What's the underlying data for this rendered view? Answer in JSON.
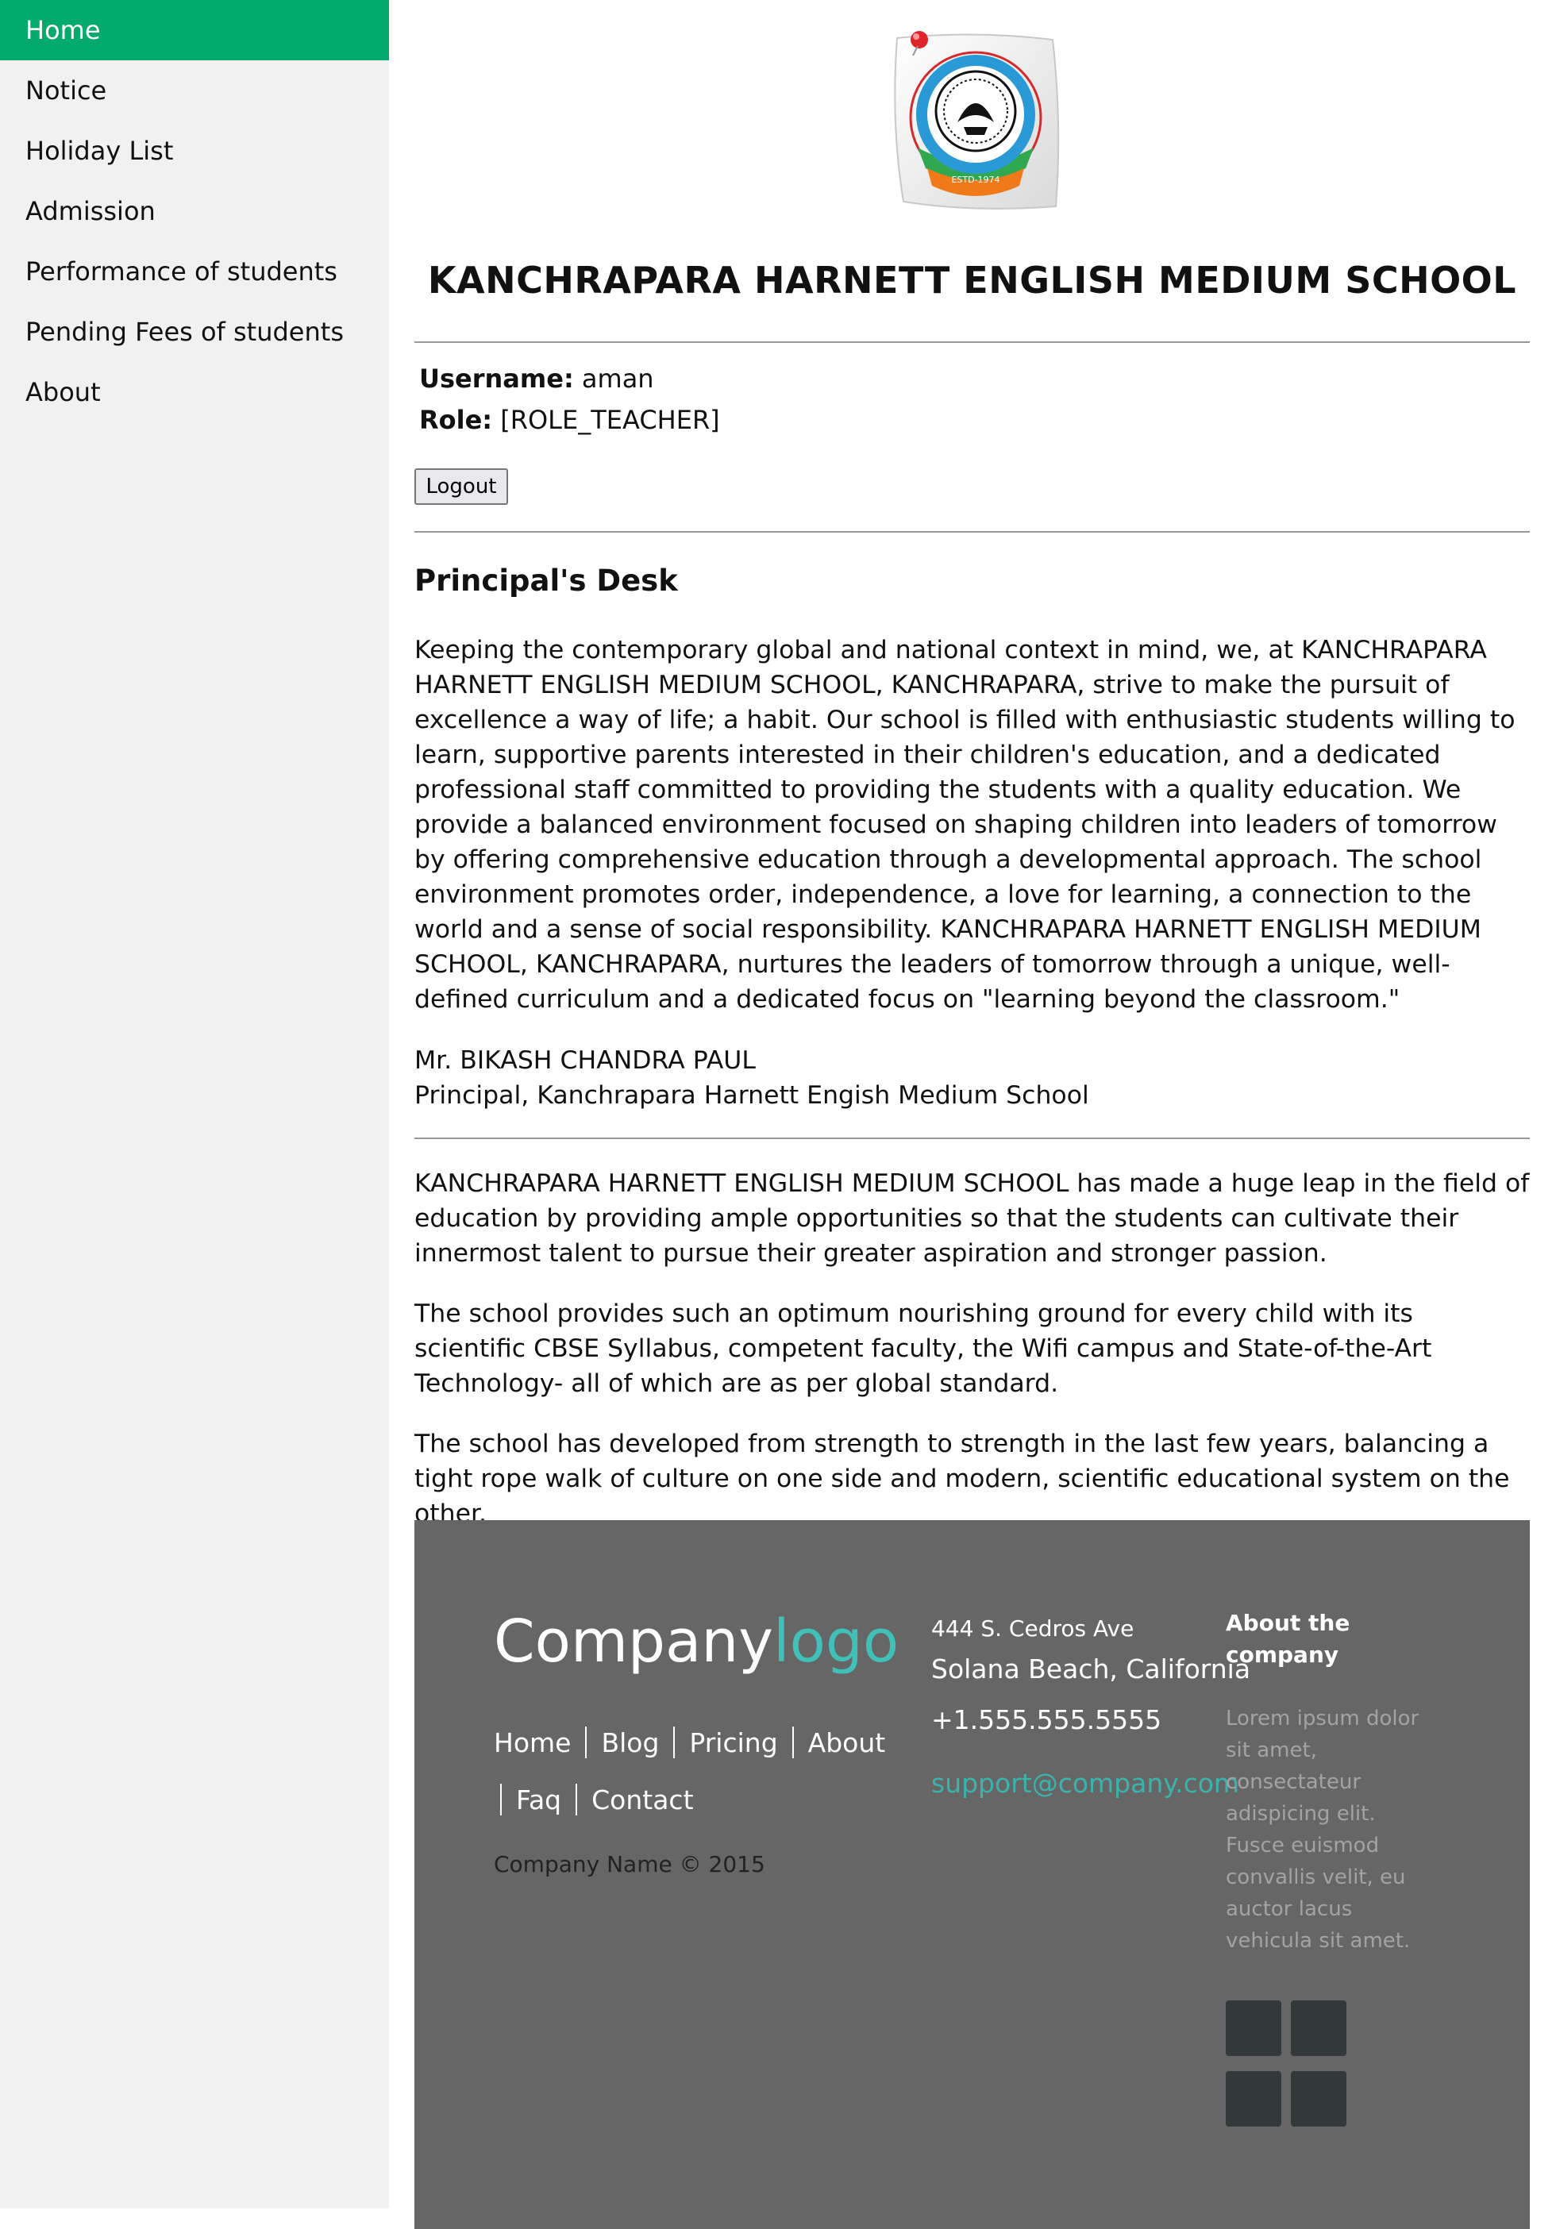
{
  "sidebar": {
    "items": [
      {
        "label": "Home"
      },
      {
        "label": "Notice"
      },
      {
        "label": "Holiday List"
      },
      {
        "label": "Admission"
      },
      {
        "label": "Performance of students"
      },
      {
        "label": "Pending Fees of students"
      },
      {
        "label": "About"
      }
    ],
    "active_index": 0
  },
  "header": {
    "school_title": "KANCHRAPARA HARNETT ENGLISH MEDIUM SCHOOL",
    "logo_estd": "ESTD-1974",
    "logo_ring_text": "Kanchrapara Harnett English Medium School"
  },
  "user": {
    "username_label": "Username:",
    "username_value": "aman",
    "role_label": "Role:",
    "role_value": "[ROLE_TEACHER]",
    "logout_label": "Logout"
  },
  "principal_desk": {
    "title": "Principal's Desk",
    "message": "Keeping the contemporary global and national context in mind, we, at KANCHRAPARA HARNETT ENGLISH MEDIUM SCHOOL, KANCHRAPARA, strive to make the pursuit of excellence a way of life; a habit. Our school is filled with enthusiastic students willing to learn, supportive parents interested in their children's education, and a dedicated professional staff committed to providing the students with a quality education. We provide a balanced environment focused on shaping children into leaders of tomorrow by offering comprehensive education through a developmental approach. The school environment promotes order, independence, a love for learning, a connection to the world and a sense of social responsibility. KANCHRAPARA HARNETT ENGLISH MEDIUM SCHOOL, KANCHRAPARA, nurtures the leaders of tomorrow through a unique, well-defined curriculum and a dedicated focus on \"learning beyond the classroom.\"",
    "signatory_name": "Mr. BIKASH CHANDRA PAUL",
    "signatory_title": "Principal, Kanchrapara Harnett Engish Medium School"
  },
  "about_paragraphs": [
    "KANCHRAPARA HARNETT ENGLISH MEDIUM SCHOOL has made a huge leap in the field of education by providing ample opportunities so that the students can cultivate their innermost talent to pursue their greater aspiration and stronger passion.",
    "The school provides such an optimum nourishing ground for every child with its scientific CBSE Syllabus, competent faculty, the Wifi campus and State-of-the-Art Technology- all of which are as per global standard.",
    "The school has developed from strength to strength in the last few years, balancing a tight rope walk of culture on one side and modern, scientific educational system on the other."
  ],
  "footer": {
    "logo_main": "Company",
    "logo_accent": "logo",
    "links": [
      "Home",
      "Blog",
      "Pricing",
      "About",
      "Faq",
      "Contact"
    ],
    "copyright": "Company Name © 2015",
    "address_line1": "444 S. Cedros Ave",
    "address_line2": "Solana Beach, California",
    "phone": "+1.555.555.5555",
    "email": "support@company.com",
    "about_title": "About the company",
    "about_text": "Lorem ipsum dolor sit amet, consectateur adispicing elit. Fusce euismod convallis velit, eu auctor lacus vehicula sit amet."
  },
  "colors": {
    "accent_green": "#04aa6d",
    "sidebar_bg": "#f1f1f1",
    "footer_bg": "#666666",
    "footer_accent": "#40c0b8"
  }
}
